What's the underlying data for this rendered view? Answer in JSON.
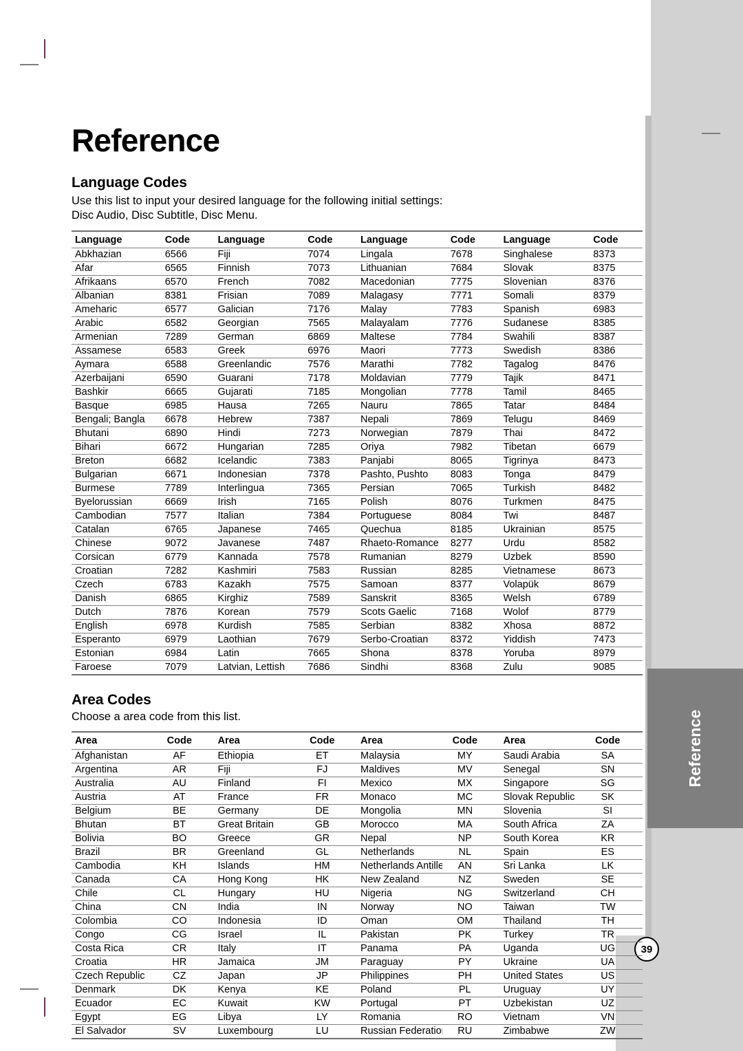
{
  "page": {
    "title": "Reference",
    "number": "39",
    "side_tab_label": "Reference"
  },
  "language_section": {
    "heading": "Language Codes",
    "intro_line1": "Use this list to input your desired language for the following initial settings:",
    "intro_line2": "Disc Audio, Disc Subtitle, Disc Menu.",
    "header_name": "Language",
    "header_code": "Code",
    "columns": [
      {
        "rows": [
          {
            "name": "Abkhazian",
            "code": "6566"
          },
          {
            "name": "Afar",
            "code": "6565"
          },
          {
            "name": "Afrikaans",
            "code": "6570"
          },
          {
            "name": "Albanian",
            "code": "8381"
          },
          {
            "name": "Ameharic",
            "code": "6577"
          },
          {
            "name": "Arabic",
            "code": "6582"
          },
          {
            "name": "Armenian",
            "code": "7289"
          },
          {
            "name": "Assamese",
            "code": "6583"
          },
          {
            "name": "Aymara",
            "code": "6588"
          },
          {
            "name": "Azerbaijani",
            "code": "6590"
          },
          {
            "name": "Bashkir",
            "code": "6665"
          },
          {
            "name": "Basque",
            "code": "6985"
          },
          {
            "name": "Bengali; Bangla",
            "code": "6678"
          },
          {
            "name": "Bhutani",
            "code": "6890"
          },
          {
            "name": "Bihari",
            "code": "6672"
          },
          {
            "name": "Breton",
            "code": "6682"
          },
          {
            "name": "Bulgarian",
            "code": "6671"
          },
          {
            "name": "Burmese",
            "code": "7789"
          },
          {
            "name": "Byelorussian",
            "code": "6669"
          },
          {
            "name": "Cambodian",
            "code": "7577"
          },
          {
            "name": "Catalan",
            "code": "6765"
          },
          {
            "name": "Chinese",
            "code": "9072"
          },
          {
            "name": "Corsican",
            "code": "6779"
          },
          {
            "name": "Croatian",
            "code": "7282"
          },
          {
            "name": "Czech",
            "code": "6783"
          },
          {
            "name": "Danish",
            "code": "6865"
          },
          {
            "name": "Dutch",
            "code": "7876"
          },
          {
            "name": "English",
            "code": "6978"
          },
          {
            "name": "Esperanto",
            "code": "6979"
          },
          {
            "name": "Estonian",
            "code": "6984"
          },
          {
            "name": "Faroese",
            "code": "7079"
          }
        ]
      },
      {
        "rows": [
          {
            "name": "Fiji",
            "code": "7074"
          },
          {
            "name": "Finnish",
            "code": "7073"
          },
          {
            "name": "French",
            "code": "7082"
          },
          {
            "name": "Frisian",
            "code": "7089"
          },
          {
            "name": "Galician",
            "code": "7176"
          },
          {
            "name": "Georgian",
            "code": "7565"
          },
          {
            "name": "German",
            "code": "6869"
          },
          {
            "name": "Greek",
            "code": "6976"
          },
          {
            "name": "Greenlandic",
            "code": "7576"
          },
          {
            "name": "Guarani",
            "code": "7178"
          },
          {
            "name": "Gujarati",
            "code": "7185"
          },
          {
            "name": "Hausa",
            "code": "7265"
          },
          {
            "name": "Hebrew",
            "code": "7387"
          },
          {
            "name": "Hindi",
            "code": "7273"
          },
          {
            "name": "Hungarian",
            "code": "7285"
          },
          {
            "name": "Icelandic",
            "code": "7383"
          },
          {
            "name": "Indonesian",
            "code": "7378"
          },
          {
            "name": "Interlingua",
            "code": "7365"
          },
          {
            "name": "Irish",
            "code": "7165"
          },
          {
            "name": "Italian",
            "code": "7384"
          },
          {
            "name": "Japanese",
            "code": "7465"
          },
          {
            "name": "Javanese",
            "code": "7487"
          },
          {
            "name": "Kannada",
            "code": "7578"
          },
          {
            "name": "Kashmiri",
            "code": "7583"
          },
          {
            "name": "Kazakh",
            "code": "7575"
          },
          {
            "name": "Kirghiz",
            "code": "7589"
          },
          {
            "name": "Korean",
            "code": "7579"
          },
          {
            "name": "Kurdish",
            "code": "7585"
          },
          {
            "name": "Laothian",
            "code": "7679"
          },
          {
            "name": "Latin",
            "code": "7665"
          },
          {
            "name": "Latvian, Lettish",
            "code": "7686"
          }
        ]
      },
      {
        "rows": [
          {
            "name": "Lingala",
            "code": "7678"
          },
          {
            "name": "Lithuanian",
            "code": "7684"
          },
          {
            "name": "Macedonian",
            "code": "7775"
          },
          {
            "name": "Malagasy",
            "code": "7771"
          },
          {
            "name": "Malay",
            "code": "7783"
          },
          {
            "name": "Malayalam",
            "code": "7776"
          },
          {
            "name": "Maltese",
            "code": "7784"
          },
          {
            "name": "Maori",
            "code": "7773"
          },
          {
            "name": "Marathi",
            "code": "7782"
          },
          {
            "name": "Moldavian",
            "code": "7779"
          },
          {
            "name": "Mongolian",
            "code": "7778"
          },
          {
            "name": "Nauru",
            "code": "7865"
          },
          {
            "name": "Nepali",
            "code": "7869"
          },
          {
            "name": "Norwegian",
            "code": "7879"
          },
          {
            "name": "Oriya",
            "code": "7982"
          },
          {
            "name": "Panjabi",
            "code": "8065"
          },
          {
            "name": "Pashto, Pushto",
            "code": "8083"
          },
          {
            "name": "Persian",
            "code": "7065"
          },
          {
            "name": "Polish",
            "code": "8076"
          },
          {
            "name": "Portuguese",
            "code": "8084"
          },
          {
            "name": "Quechua",
            "code": "8185"
          },
          {
            "name": "Rhaeto-Romance",
            "code": "8277"
          },
          {
            "name": "Rumanian",
            "code": "8279"
          },
          {
            "name": "Russian",
            "code": "8285"
          },
          {
            "name": "Samoan",
            "code": "8377"
          },
          {
            "name": "Sanskrit",
            "code": "8365"
          },
          {
            "name": "Scots Gaelic",
            "code": "7168"
          },
          {
            "name": "Serbian",
            "code": "8382"
          },
          {
            "name": "Serbo-Croatian",
            "code": "8372"
          },
          {
            "name": "Shona",
            "code": "8378"
          },
          {
            "name": "Sindhi",
            "code": "8368"
          }
        ]
      },
      {
        "rows": [
          {
            "name": "Singhalese",
            "code": "8373"
          },
          {
            "name": "Slovak",
            "code": "8375"
          },
          {
            "name": "Slovenian",
            "code": "8376"
          },
          {
            "name": "Somali",
            "code": "8379"
          },
          {
            "name": "Spanish",
            "code": "6983"
          },
          {
            "name": "Sudanese",
            "code": "8385"
          },
          {
            "name": "Swahili",
            "code": "8387"
          },
          {
            "name": "Swedish",
            "code": "8386"
          },
          {
            "name": "Tagalog",
            "code": "8476"
          },
          {
            "name": "Tajik",
            "code": "8471"
          },
          {
            "name": "Tamil",
            "code": "8465"
          },
          {
            "name": "Tatar",
            "code": "8484"
          },
          {
            "name": "Telugu",
            "code": "8469"
          },
          {
            "name": "Thai",
            "code": "8472"
          },
          {
            "name": "Tibetan",
            "code": "6679"
          },
          {
            "name": "Tigrinya",
            "code": "8473"
          },
          {
            "name": "Tonga",
            "code": "8479"
          },
          {
            "name": "Turkish",
            "code": "8482"
          },
          {
            "name": "Turkmen",
            "code": "8475"
          },
          {
            "name": "Twi",
            "code": "8487"
          },
          {
            "name": "Ukrainian",
            "code": "8575"
          },
          {
            "name": "Urdu",
            "code": "8582"
          },
          {
            "name": "Uzbek",
            "code": "8590"
          },
          {
            "name": "Vietnamese",
            "code": "8673"
          },
          {
            "name": "Volapük",
            "code": "8679"
          },
          {
            "name": "Welsh",
            "code": "6789"
          },
          {
            "name": "Wolof",
            "code": "8779"
          },
          {
            "name": "Xhosa",
            "code": "8872"
          },
          {
            "name": "Yiddish",
            "code": "7473"
          },
          {
            "name": "Yoruba",
            "code": "8979"
          },
          {
            "name": "Zulu",
            "code": "9085"
          }
        ]
      }
    ]
  },
  "area_section": {
    "heading": "Area Codes",
    "intro_line1": "Choose a area code from this list.",
    "header_name": "Area",
    "header_code": "Code",
    "columns": [
      {
        "rows": [
          {
            "name": "Afghanistan",
            "code": "AF"
          },
          {
            "name": "Argentina",
            "code": "AR"
          },
          {
            "name": "Australia",
            "code": "AU"
          },
          {
            "name": "Austria",
            "code": "AT"
          },
          {
            "name": "Belgium",
            "code": "BE"
          },
          {
            "name": "Bhutan",
            "code": "BT"
          },
          {
            "name": "Bolivia",
            "code": "BO"
          },
          {
            "name": "Brazil",
            "code": "BR"
          },
          {
            "name": "Cambodia",
            "code": "KH"
          },
          {
            "name": "Canada",
            "code": "CA"
          },
          {
            "name": "Chile",
            "code": "CL"
          },
          {
            "name": "China",
            "code": "CN"
          },
          {
            "name": "Colombia",
            "code": "CO"
          },
          {
            "name": "Congo",
            "code": "CG"
          },
          {
            "name": "Costa Rica",
            "code": "CR"
          },
          {
            "name": "Croatia",
            "code": "HR"
          },
          {
            "name": "Czech Republic",
            "code": "CZ"
          },
          {
            "name": "Denmark",
            "code": "DK"
          },
          {
            "name": "Ecuador",
            "code": "EC"
          },
          {
            "name": "Egypt",
            "code": "EG"
          },
          {
            "name": "El Salvador",
            "code": "SV"
          }
        ]
      },
      {
        "rows": [
          {
            "name": "Ethiopia",
            "code": "ET"
          },
          {
            "name": "Fiji",
            "code": "FJ"
          },
          {
            "name": "Finland",
            "code": "FI"
          },
          {
            "name": "France",
            "code": "FR"
          },
          {
            "name": "Germany",
            "code": "DE"
          },
          {
            "name": "Great Britain",
            "code": "GB"
          },
          {
            "name": "Greece",
            "code": "GR"
          },
          {
            "name": "Greenland",
            "code": "GL"
          },
          {
            "name": "Islands",
            "code": "HM"
          },
          {
            "name": "Hong Kong",
            "code": "HK"
          },
          {
            "name": "Hungary",
            "code": "HU"
          },
          {
            "name": "India",
            "code": "IN"
          },
          {
            "name": "Indonesia",
            "code": "ID"
          },
          {
            "name": "Israel",
            "code": "IL"
          },
          {
            "name": "Italy",
            "code": "IT"
          },
          {
            "name": "Jamaica",
            "code": "JM"
          },
          {
            "name": "Japan",
            "code": "JP"
          },
          {
            "name": "Kenya",
            "code": "KE"
          },
          {
            "name": "Kuwait",
            "code": "KW"
          },
          {
            "name": "Libya",
            "code": "LY"
          },
          {
            "name": "Luxembourg",
            "code": "LU"
          }
        ]
      },
      {
        "rows": [
          {
            "name": "Malaysia",
            "code": "MY"
          },
          {
            "name": "Maldives",
            "code": "MV"
          },
          {
            "name": "Mexico",
            "code": "MX"
          },
          {
            "name": "Monaco",
            "code": "MC"
          },
          {
            "name": "Mongolia",
            "code": "MN"
          },
          {
            "name": "Morocco",
            "code": "MA"
          },
          {
            "name": "Nepal",
            "code": "NP"
          },
          {
            "name": "Netherlands",
            "code": "NL"
          },
          {
            "name": "Netherlands Antilles",
            "code": "AN"
          },
          {
            "name": "New Zealand",
            "code": "NZ"
          },
          {
            "name": "Nigeria",
            "code": "NG"
          },
          {
            "name": "Norway",
            "code": "NO"
          },
          {
            "name": "Oman",
            "code": "OM"
          },
          {
            "name": "Pakistan",
            "code": "PK"
          },
          {
            "name": "Panama",
            "code": "PA"
          },
          {
            "name": "Paraguay",
            "code": "PY"
          },
          {
            "name": "Philippines",
            "code": "PH"
          },
          {
            "name": "Poland",
            "code": "PL"
          },
          {
            "name": "Portugal",
            "code": "PT"
          },
          {
            "name": "Romania",
            "code": "RO"
          },
          {
            "name": "Russian Federation",
            "code": "RU"
          }
        ]
      },
      {
        "rows": [
          {
            "name": "Saudi Arabia",
            "code": "SA"
          },
          {
            "name": "Senegal",
            "code": "SN"
          },
          {
            "name": "Singapore",
            "code": "SG"
          },
          {
            "name": "Slovak Republic",
            "code": "SK"
          },
          {
            "name": "Slovenia",
            "code": "SI"
          },
          {
            "name": "South Africa",
            "code": "ZA"
          },
          {
            "name": "South Korea",
            "code": "KR"
          },
          {
            "name": "Spain",
            "code": "ES"
          },
          {
            "name": "Sri Lanka",
            "code": "LK"
          },
          {
            "name": "Sweden",
            "code": "SE"
          },
          {
            "name": "Switzerland",
            "code": "CH"
          },
          {
            "name": "Taiwan",
            "code": "TW"
          },
          {
            "name": "Thailand",
            "code": "TH"
          },
          {
            "name": "Turkey",
            "code": "TR"
          },
          {
            "name": "Uganda",
            "code": "UG"
          },
          {
            "name": "Ukraine",
            "code": "UA"
          },
          {
            "name": "United States",
            "code": "US"
          },
          {
            "name": "Uruguay",
            "code": "UY"
          },
          {
            "name": "Uzbekistan",
            "code": "UZ"
          },
          {
            "name": "Vietnam",
            "code": "VN"
          },
          {
            "name": "Zimbabwe",
            "code": "ZW"
          }
        ]
      }
    ]
  },
  "colors": {
    "tab_gray": "#7f7f7f",
    "band_gray": "#d2d2d2",
    "rule_gray": "#808080"
  }
}
